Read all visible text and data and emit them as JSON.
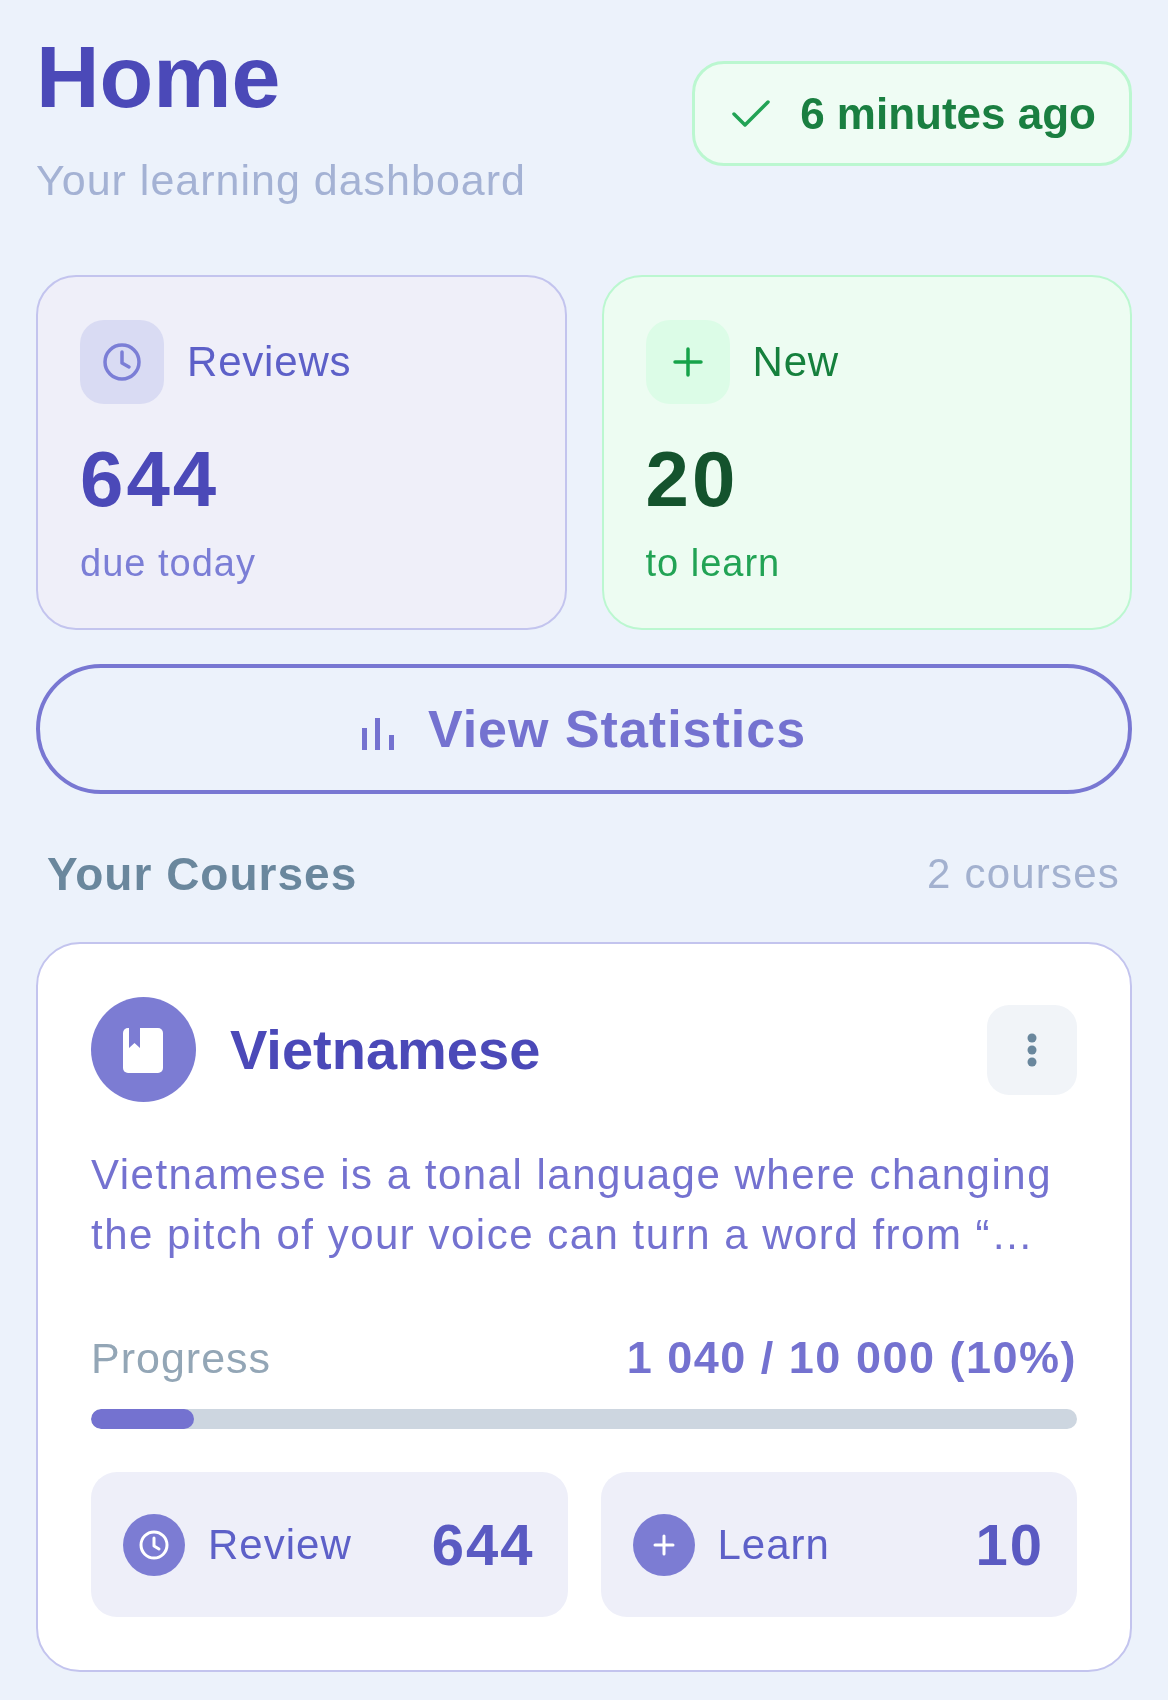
{
  "header": {
    "title": "Home",
    "subtitle": "Your learning dashboard",
    "sync_status": {
      "kind": "synced",
      "label": "6 minutes ago"
    }
  },
  "stat_cards": [
    {
      "kind": "reviews",
      "label": "Reviews",
      "value": "644",
      "caption": "due today"
    },
    {
      "kind": "new",
      "label": "New",
      "value": "20",
      "caption": "to learn"
    }
  ],
  "statistics_button": {
    "label": "View Statistics"
  },
  "courses_section": {
    "title": "Your Courses",
    "count": "2 courses",
    "courses": [
      {
        "name": "Vietnamese",
        "description": "Vietnamese is a tonal language where changing the pitch of your voice can turn a word from “…",
        "progress": {
          "label": "Progress",
          "reading": "1 040 / 10 000 (10%)",
          "level": 0.104
        },
        "actions": [
          {
            "kind": "review",
            "label": "Review",
            "count": "644"
          },
          {
            "kind": "learn",
            "label": "Learn",
            "count": "10"
          }
        ]
      }
    ]
  }
}
